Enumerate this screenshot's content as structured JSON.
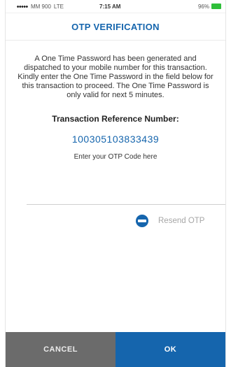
{
  "status_bar": {
    "carrier": "MM 900",
    "network": "LTE",
    "time": "7:15 AM",
    "battery": "96%"
  },
  "header": {
    "title": "OTP VERIFICATION"
  },
  "body": {
    "description": "A One Time Password has been generated and dispatched to your mobile number for this transaction. Kindly enter the One Time Password in the field below for this transaction to proceed.  The One Time Password is only valid for next 5 minutes.",
    "ref_label": "Transaction Reference Number:",
    "ref_number": "100305103833439",
    "otp_hint": "Enter your OTP Code here",
    "otp_value": ""
  },
  "resend": {
    "icon": "otp-icon",
    "label": "Resend OTP"
  },
  "footer": {
    "cancel_label": "CANCEL",
    "ok_label": "OK"
  },
  "colors": {
    "brand_blue": "#1565ad",
    "cancel_gray": "#6b6b6b",
    "battery_green": "#2fbf3a"
  }
}
